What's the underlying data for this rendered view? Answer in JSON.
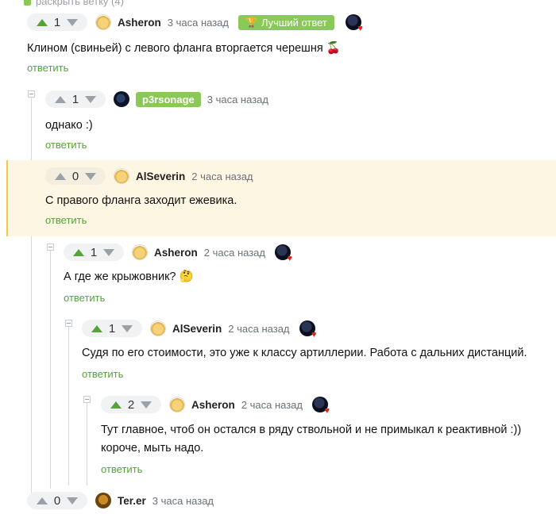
{
  "top_cut": "раскрыть ветку (4)",
  "comments": [
    {
      "rating": "1",
      "author": "Asheron",
      "time": "3 часа назад",
      "best_label": "Лучший ответ",
      "text": "Клином (свиньей) с левого фланга вторгается черешня 🍒",
      "reply": "ответить"
    },
    {
      "rating": "1",
      "author": "p3rsonage",
      "time": "3 часа назад",
      "text": "однако :)",
      "reply": "ответить"
    },
    {
      "rating": "0",
      "author": "AlSeverin",
      "time": "2 часа назад",
      "text": "С правого фланга заходит ежевика.",
      "reply": "ответить"
    },
    {
      "rating": "1",
      "author": "Asheron",
      "time": "2 часа назад",
      "text": "А где же крыжовник? 🤔",
      "reply": "ответить"
    },
    {
      "rating": "1",
      "author": "AlSeverin",
      "time": "2 часа назад",
      "text": "Судя по его стоимости, это уже к классу артиллерии. Работа с дальних дистанций.",
      "reply": "ответить"
    },
    {
      "rating": "2",
      "author": "Asheron",
      "time": "2 часа назад",
      "text_line1": "Тут главное, чтоб он остался в ряду ствольной и не примыкал к реактивной :))",
      "text_line2": "короче, мыть надо.",
      "reply": "ответить"
    },
    {
      "rating": "0",
      "author": "Ter.er",
      "time": "3 часа назад"
    }
  ],
  "colors": {
    "accent": "#8ac858",
    "upvote": "#56a33a",
    "highlight_bg": "#fdf6e3",
    "highlight_border": "#f3c84b"
  }
}
